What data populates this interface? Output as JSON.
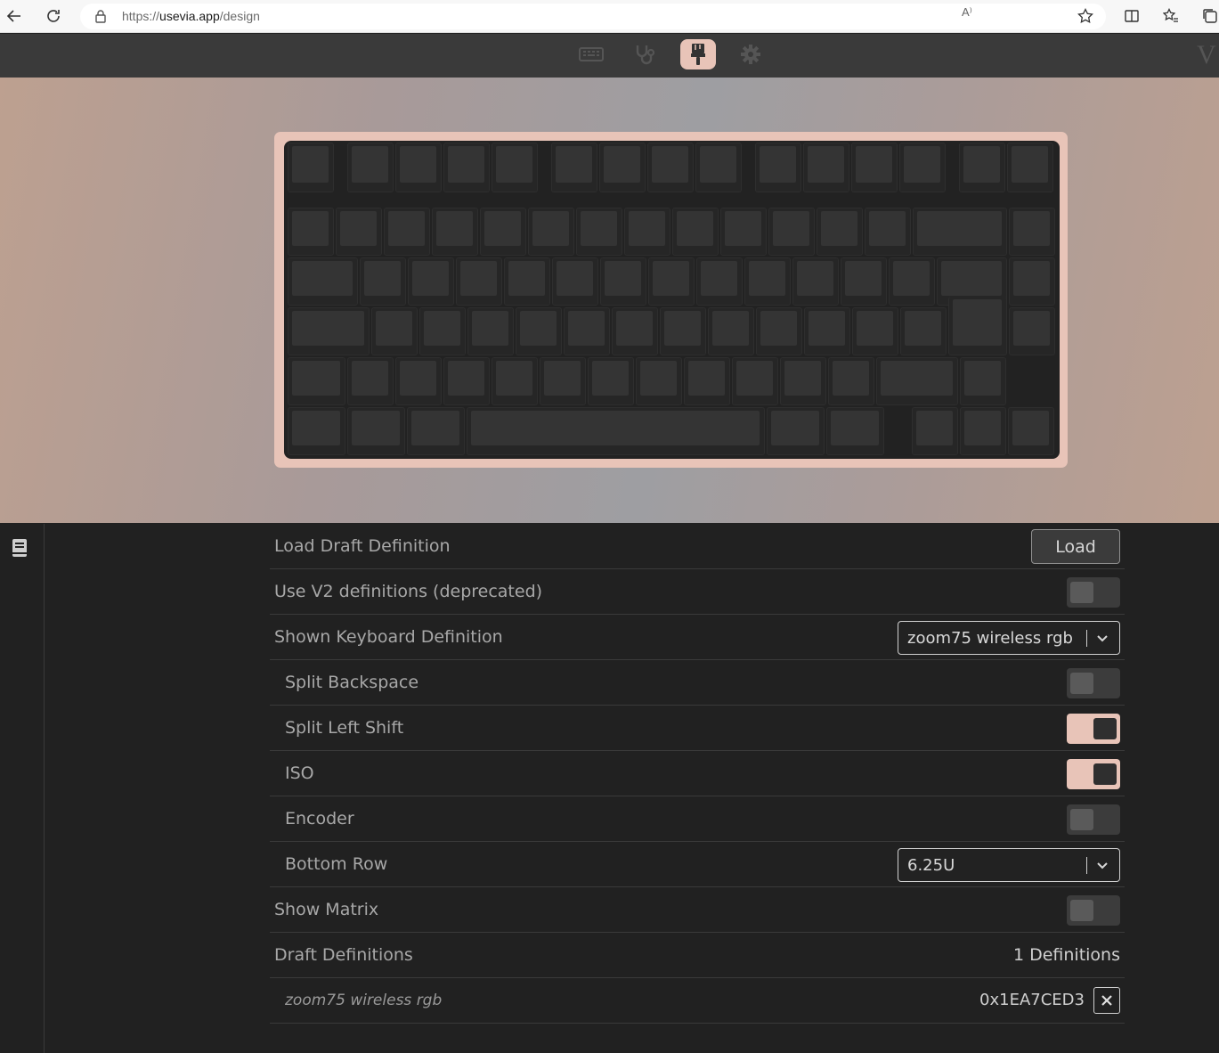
{
  "browser": {
    "url_prefix": "https://",
    "url_host": "usevia.app",
    "url_path": "/design",
    "read_aloud_glyph": "A⁾"
  },
  "nav": {
    "items": [
      {
        "name": "keyboard-icon",
        "active": false
      },
      {
        "name": "stethoscope-icon",
        "active": false
      },
      {
        "name": "paintbrush-icon",
        "active": true
      },
      {
        "name": "gear-icon",
        "active": false
      }
    ],
    "logo": "V"
  },
  "colors": {
    "accent": "#e8c4b8",
    "background": "#212121",
    "nav": "#3a3a3a"
  },
  "settings": {
    "load_draft": {
      "label": "Load Draft Definition",
      "button": "Load"
    },
    "use_v2": {
      "label": "Use V2 definitions (deprecated)",
      "on": false
    },
    "shown_keyboard": {
      "label": "Shown Keyboard Definition",
      "value": "zoom75 wireless rgb"
    },
    "split_backspace": {
      "label": "Split Backspace",
      "on": false
    },
    "split_left_shift": {
      "label": "Split Left Shift",
      "on": true
    },
    "iso": {
      "label": "ISO",
      "on": true
    },
    "encoder": {
      "label": "Encoder",
      "on": false
    },
    "bottom_row": {
      "label": "Bottom Row",
      "value": "6.25U"
    },
    "show_matrix": {
      "label": "Show Matrix",
      "on": false
    },
    "draft_definitions": {
      "label": "Draft Definitions",
      "count": "1 Definitions"
    },
    "definition_item": {
      "name": "zoom75 wireless rgb",
      "id": "0x1EA7CED3"
    }
  }
}
